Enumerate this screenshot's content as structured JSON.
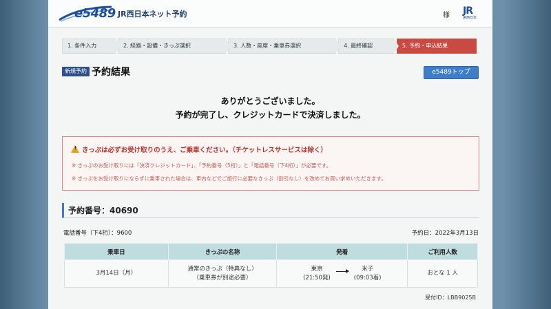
{
  "header": {
    "logo_text": "e5489",
    "site_name": "JR西日本ネット予約",
    "user_suffix": "様",
    "jr_logo": "JR",
    "jr_sub": "JR西日本"
  },
  "steps": [
    {
      "label": "1. 条件入力",
      "active": false
    },
    {
      "label": "2. 経路・設備・きっぷ選択",
      "active": false
    },
    {
      "label": "3. 人数・座席・乗車券選択",
      "active": false
    },
    {
      "label": "4. 最終確認",
      "active": false
    },
    {
      "label": "5. 予約・申込結果",
      "active": true
    }
  ],
  "title": {
    "badge": "新規予約",
    "text": "予約結果",
    "top_button": "e5489トップ"
  },
  "message": {
    "line1": "ありがとうございました。",
    "line2": "予約が完了し、クレジットカードで決済しました。"
  },
  "warning": {
    "icon": "warning-triangle-icon",
    "heading": "きっぷは必ずお受け取りのうえ、ご乗車ください。（チケットレスサービスは除く）",
    "note1": "※ きっぷのお受け取りには「決済クレジットカード」、「予約番号（5桁）」と「電話番号（下4桁）」が必要です。",
    "note2": "※ きっぷをお受け取りにならずに乗車された場合は、車内などでご旅行に必要なきっぷ（割引なし）を改めてお買い求めいただきます。"
  },
  "reservation": {
    "number_label": "予約番号：40690",
    "phone": "電話番号（下4桁）：9600",
    "date": "予約日：2022年3月13日",
    "receipt_id": "受付ID：LBB9025B"
  },
  "table": {
    "headers": [
      "乗車日",
      "きっぷの名称",
      "発着",
      "ご利用人数"
    ],
    "row": {
      "date": "3月14日（月）",
      "ticket_line1": "通常のきっぷ（特典なし）",
      "ticket_line2": "（乗車券が別途必要）",
      "from_station": "東京",
      "from_time": "(21:50発)",
      "to_station": "米子",
      "to_time": "(09:03着)",
      "people": "おとな 1 人"
    }
  },
  "colors": {
    "accent_blue": "#3e7ec9",
    "active_step": "#c94a41",
    "warning_red": "#b8312b",
    "table_header": "#bfdcdf"
  }
}
